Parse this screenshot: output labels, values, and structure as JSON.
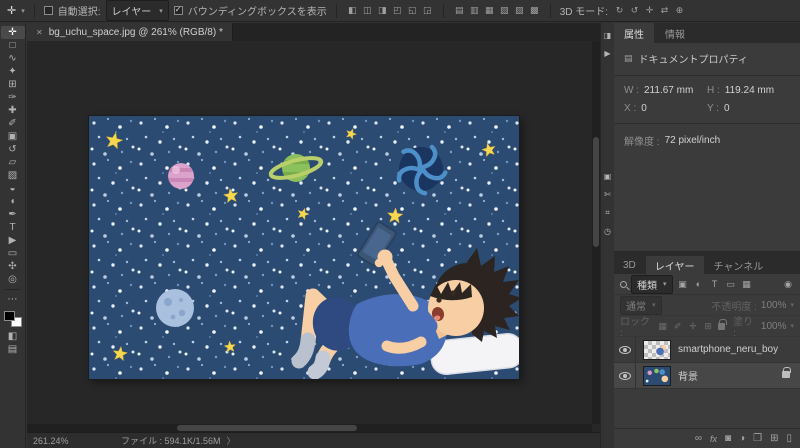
{
  "ui": {
    "caret": "▾",
    "accent": "#2d8ceb",
    "panel_bg": "#3b3b3b",
    "pasteboard": "#272727"
  },
  "options_bar": {
    "tool_icon": "✛",
    "auto_select_label": "自動選択:",
    "auto_select_value": "レイヤー",
    "bbox_label": "バウンディングボックスを表示",
    "align_icons": [
      "◧",
      "◫",
      "◨",
      "◰",
      "◱",
      "◲"
    ],
    "distribute_icons": [
      "▤",
      "▥",
      "▦",
      "▧",
      "▨",
      "▩"
    ],
    "mode_label": "3D モード:",
    "mode_icons": [
      "↻",
      "↺",
      "✛",
      "⇄",
      "⊕"
    ]
  },
  "tab_bar": {
    "close": "✕",
    "title": "bg_uchu_space.jpg @ 261% (RGB/8) *"
  },
  "toolbar": {
    "tools": [
      {
        "name": "move",
        "glyph": "✛"
      },
      {
        "name": "marquee",
        "glyph": "□"
      },
      {
        "name": "lasso",
        "glyph": "∿"
      },
      {
        "name": "quick-select",
        "glyph": "✦"
      },
      {
        "name": "crop",
        "glyph": "⊞"
      },
      {
        "name": "eyedropper",
        "glyph": "✑"
      },
      {
        "name": "healing-brush",
        "glyph": "✚"
      },
      {
        "name": "brush",
        "glyph": "✐"
      },
      {
        "name": "clone-stamp",
        "glyph": "▣"
      },
      {
        "name": "history-brush",
        "glyph": "↺"
      },
      {
        "name": "eraser",
        "glyph": "▱"
      },
      {
        "name": "gradient",
        "glyph": "▨"
      },
      {
        "name": "blur",
        "glyph": "◒"
      },
      {
        "name": "dodge",
        "glyph": "◖"
      },
      {
        "name": "pen",
        "glyph": "✒"
      },
      {
        "name": "type",
        "glyph": "T"
      },
      {
        "name": "path-select",
        "glyph": "▶"
      },
      {
        "name": "shape",
        "glyph": "▭"
      },
      {
        "name": "hand",
        "glyph": "✣"
      },
      {
        "name": "zoom",
        "glyph": "◎"
      }
    ],
    "more_icon": "⋯",
    "quick_mask_icon": "◧",
    "screen_mode_icon": "▤"
  },
  "panel_strip": {
    "icons": [
      "◨",
      "▶",
      "▣",
      "✄",
      "⌗",
      "◷"
    ]
  },
  "properties_panel": {
    "tab_properties": "属性",
    "tab_info": "情報",
    "header_icon": "▤",
    "header": "ドキュメントプロパティ",
    "w_label": "W :",
    "w_value": "211.67 mm",
    "h_label": "H :",
    "h_value": "119.24 mm",
    "x_label": "X :",
    "x_value": "0",
    "y_label": "Y :",
    "y_value": "0",
    "res_label": "解像度 :",
    "res_value": "72 pixel/inch"
  },
  "layers_panel": {
    "tab_3d": "3D",
    "tab_layers": "レイヤー",
    "tab_channels": "チャンネル",
    "filter_label": "種類",
    "filter_icons": [
      "▣",
      "◐",
      "T",
      "▭",
      "▦"
    ],
    "filter_switch": "◉",
    "blend_value": "通常",
    "opacity_label": "不透明度 :",
    "opacity_value": "100%",
    "lock_label": "ロック :",
    "lock_icons": [
      "▦",
      "✐",
      "✛",
      "⊞"
    ],
    "fill_label": "塗り :",
    "fill_value": "100%",
    "layers": [
      {
        "name": "smartphone_neru_boy"
      },
      {
        "name": "背景"
      }
    ],
    "bottom_icons": [
      "∞",
      "fx",
      "◙",
      "◑",
      "❐",
      "⊞",
      "▯"
    ]
  },
  "status_bar": {
    "zoom": "261.24%",
    "file_info": "ファイル : 594.1K/1.56M",
    "chevron": "〉"
  }
}
